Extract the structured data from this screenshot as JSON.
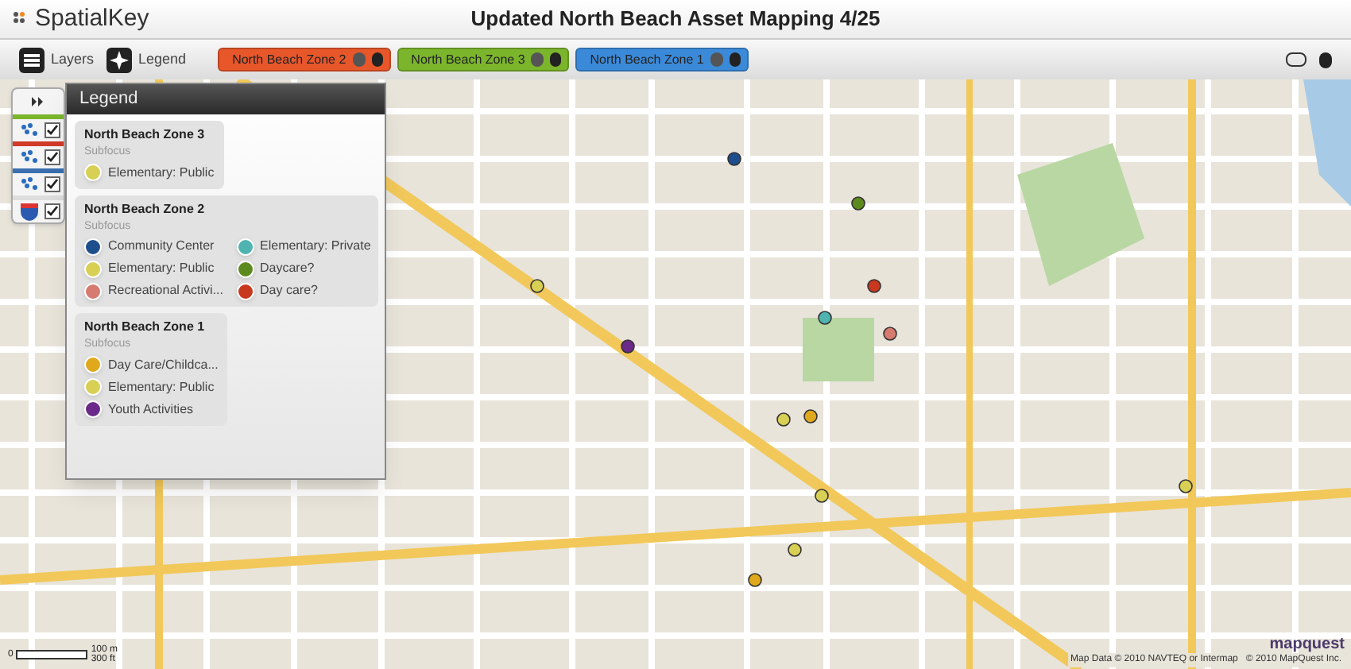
{
  "app": {
    "logo": "SpatialKey",
    "title": "Updated North Beach Asset Mapping 4/25"
  },
  "toolbar": {
    "buttons": [
      {
        "kind": "layers",
        "label": "Layers"
      },
      {
        "kind": "legend",
        "label": "Legend"
      }
    ],
    "filters": [
      {
        "label": "North Beach Zone 2",
        "color": "#e8572a"
      },
      {
        "label": "North Beach Zone 3",
        "color": "#7bb52c"
      },
      {
        "label": "North Beach Zone 1",
        "color": "#3b8ad9"
      }
    ]
  },
  "layers": [
    {
      "kind": "points",
      "color": "#7bb52c",
      "checked": true
    },
    {
      "kind": "points",
      "color": "#d23a2a",
      "checked": true
    },
    {
      "kind": "points",
      "color": "#3a6fb0",
      "checked": true
    },
    {
      "kind": "boundary",
      "checked": true
    }
  ],
  "legend": {
    "title": "Legend",
    "groups": [
      {
        "title": "North Beach Zone 3",
        "subtitle": "Subfocus",
        "items": [
          {
            "label": "Elementary: Public",
            "color": "#d8cf55"
          }
        ]
      },
      {
        "title": "North Beach Zone 2",
        "subtitle": "Subfocus",
        "items": [
          {
            "label": "Community Center",
            "color": "#1f4e8c"
          },
          {
            "label": "Elementary: Private",
            "color": "#4fb3b0"
          },
          {
            "label": "Elementary: Public",
            "color": "#d8cf55"
          },
          {
            "label": "Daycare?",
            "color": "#5d8a1e"
          },
          {
            "label": "Recreational Activi...",
            "color": "#d77a70"
          },
          {
            "label": "Day care?",
            "color": "#c8381e"
          }
        ]
      },
      {
        "title": "North Beach Zone 1",
        "subtitle": "Subfocus",
        "items": [
          {
            "label": "Day Care/Childca...",
            "color": "#e0a81c"
          },
          {
            "label": "Elementary: Public",
            "color": "#d8cf55"
          },
          {
            "label": "Youth Activities",
            "color": "#6b2a8a"
          }
        ]
      }
    ]
  },
  "scale": {
    "zero": "0",
    "metric": "100 m",
    "imperial": "300 ft"
  },
  "attribution": {
    "brand": "mapquest",
    "text": "Map Data © 2010 NAVTEQ or Intermap   © 2010 MapQuest Inc."
  }
}
